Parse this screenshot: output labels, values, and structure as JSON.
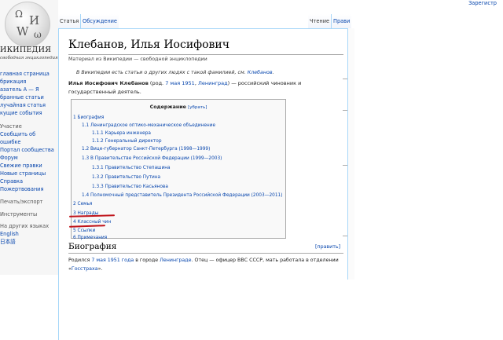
{
  "logo": {
    "wordmark": "ИКИПЕДИЯ",
    "tagline": "свободная энциклопедия",
    "globe_glyphs": [
      "Ω",
      "И",
      "W",
      "ω"
    ]
  },
  "header": {
    "login": "Зарегистр",
    "tabs": {
      "article": "Статья",
      "discussion": "Обсуждение",
      "read": "Чтение",
      "edit": "Прави"
    }
  },
  "sidebar": {
    "nav": [
      "главная страница",
      "брикация",
      "азатель А — Я",
      "бранные статьи",
      "лучайная статья",
      "кущие события"
    ],
    "interaction": [
      "Участие",
      "Сообщить об",
      "ошибке",
      "Портал сообщества",
      "Форум",
      "Свежие правки",
      "Новые страницы",
      "Справка",
      "Пожертвования"
    ],
    "tools": [
      "Печать/экспорт",
      "Инструменты"
    ],
    "languages_heading": "На других языках",
    "languages": [
      "English",
      "日本語"
    ]
  },
  "article": {
    "title": "Клебанов, Илья Иосифович",
    "site_sub": "Материал из Википедии — свободной энциклопедии",
    "hatnote": {
      "prefix": "В Википедии есть статьи о других людях с такой фамилией, см. ",
      "link": "Клебанов",
      "suffix": "."
    },
    "lead": {
      "name": "Илья Иосифович Клебанов",
      "born_open": " (род. ",
      "date": "7 мая 1951",
      "sep": ", ",
      "place": "Ленинград",
      "rest": ") — российский чиновник и государственный деятель."
    },
    "toc": {
      "title": "Содержание",
      "hide": "[убрать]",
      "items": [
        "1 Биография",
        "1.1 Ленинградское оптико-механическое объединение",
        "1.1.1 Карьера инженера",
        "1.1.2 Генеральный директор",
        "1.2 Вице-губернатор Санкт-Петербурга (1998—1999)",
        "1.3 В Правительстве Российской Федерации (1999—2003)",
        "1.3.1 Правительство Степашина",
        "1.3.2 Правительство Путина",
        "1.3.3 Правительство Касьянова",
        "1.4 Полномочный представитель Президента Российской Федерации (2003—2011)",
        "2 Семья",
        "3 Награды",
        "4 Классный чин",
        "5 Ссылки",
        "6 Примечания"
      ]
    },
    "section": {
      "heading": "Биография",
      "edit": "[править]",
      "text_parts": [
        "Родился ",
        "7 мая 1951 года",
        " в городе ",
        "Ленинграде",
        ". Отец — офицер ВВС СССР, мать работала в отделении «",
        "Госстраха",
        "»."
      ]
    }
  },
  "colors": {
    "link": "#0645ad",
    "annotation_red": "#c0141b",
    "border_blue": "#a7d7f9"
  }
}
